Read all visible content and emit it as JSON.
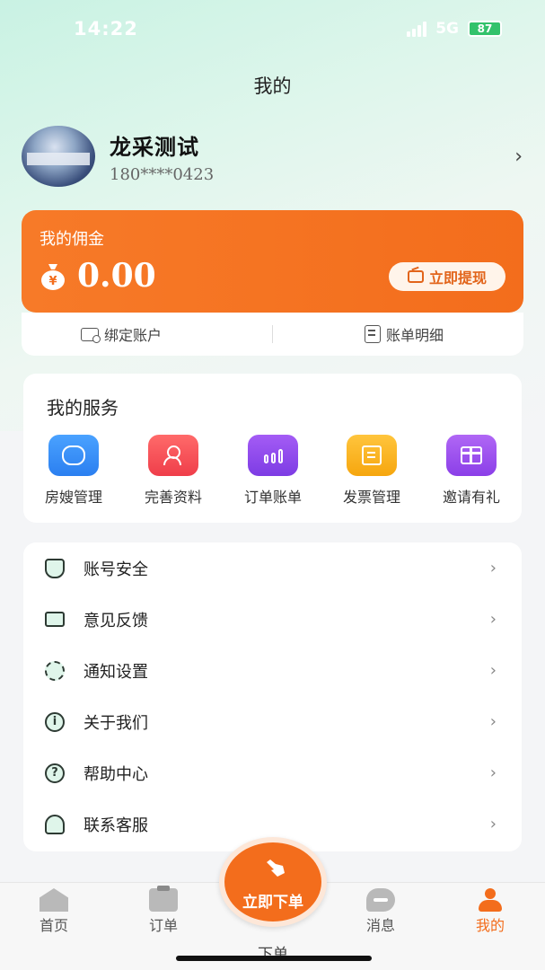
{
  "status_bar": {
    "time": "14:22",
    "network": "5G",
    "battery": "87"
  },
  "page_title": "我的",
  "profile": {
    "name": "龙采测试",
    "phone": "180****0423"
  },
  "commission": {
    "label": "我的佣金",
    "amount": "0.00",
    "withdraw_label": "立即提现"
  },
  "account": {
    "bind_label": "绑定账户",
    "bill_label": "账单明细"
  },
  "services": {
    "title": "我的服务",
    "items": [
      {
        "label": "房嫂管理",
        "icon": "housekeeper-icon"
      },
      {
        "label": "完善资料",
        "icon": "profile-icon"
      },
      {
        "label": "订单账单",
        "icon": "order-bill-icon"
      },
      {
        "label": "发票管理",
        "icon": "invoice-icon"
      },
      {
        "label": "邀请有礼",
        "icon": "gift-icon"
      }
    ]
  },
  "menu": [
    {
      "label": "账号安全",
      "icon": "account-security-icon"
    },
    {
      "label": "意见反馈",
      "icon": "feedback-icon"
    },
    {
      "label": "通知设置",
      "icon": "notification-settings-icon"
    },
    {
      "label": "关于我们",
      "icon": "info-icon"
    },
    {
      "label": "帮助中心",
      "icon": "help-icon"
    },
    {
      "label": "联系客服",
      "icon": "customer-service-icon"
    }
  ],
  "tabbar": {
    "home": "首页",
    "orders": "订单",
    "order_now": "立即下单",
    "order_caption": "下单",
    "messages": "消息",
    "me": "我的"
  },
  "colors": {
    "accent": "#f36d1c",
    "mint": "#c9f2e3"
  }
}
